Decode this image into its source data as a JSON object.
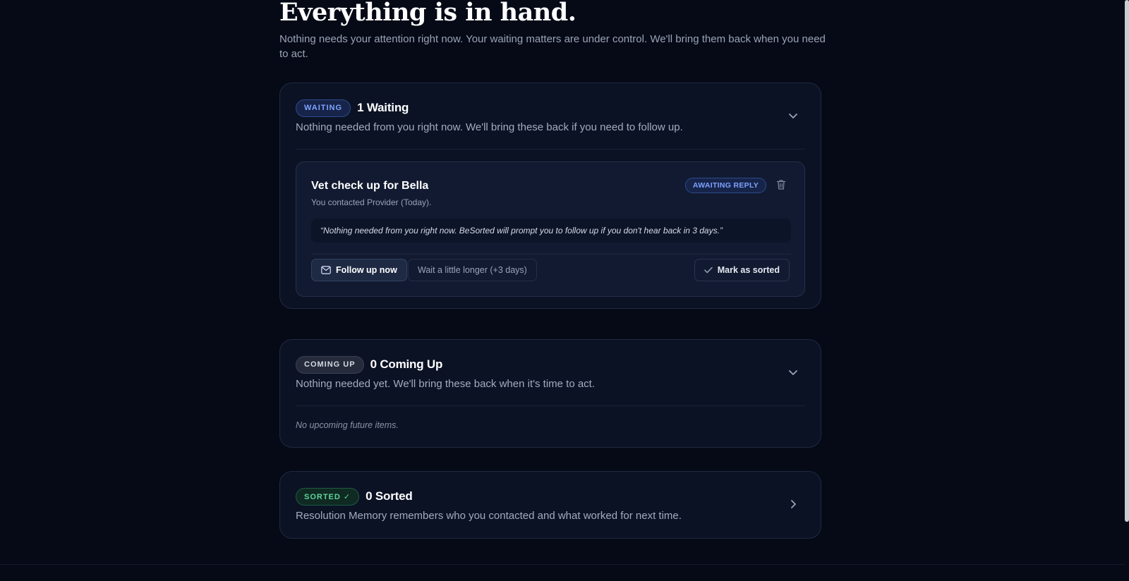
{
  "hero": {
    "title": "Everything is in hand.",
    "subtitle": "Nothing needs your attention right now. Your waiting matters are under control. We'll bring them back when you need to act."
  },
  "waiting": {
    "pill": "WAITING",
    "title": "1 Waiting",
    "description": "Nothing needed from you right now. We'll bring these back if you need to follow up.",
    "icon": "chevron-down-icon",
    "item": {
      "title": "Vet check up for Bella",
      "subtitle": "You contacted Provider (Today).",
      "status": "AWAITING REPLY",
      "quote": "“Nothing needed from you right now. BeSorted will prompt you to follow up if you don't hear back in 3 days.”",
      "follow_label": "Follow up now",
      "wait_label": "Wait a little longer (+3 days)",
      "mark_label": "Mark as sorted"
    }
  },
  "coming_up": {
    "pill": "COMING UP",
    "title": "0 Coming Up",
    "description": "Nothing needed yet. We'll bring these back when it's time to act.",
    "empty": "No upcoming future items.",
    "icon": "chevron-down-icon"
  },
  "sorted": {
    "pill": "SORTED ✓",
    "title": "0 Sorted",
    "description": "Resolution Memory remembers who you contacted and what worked for next time.",
    "icon": "chevron-right-icon"
  },
  "colors": {
    "background": "#060a16",
    "card": "#0b1224",
    "accent_blue": "#7ea3ff",
    "accent_green": "#5fd49b"
  }
}
